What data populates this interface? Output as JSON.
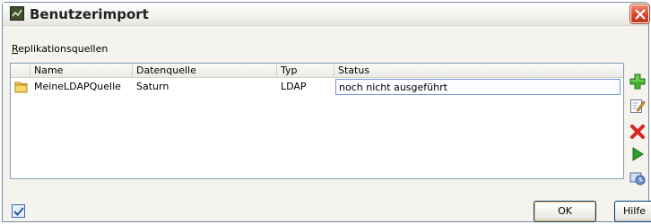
{
  "window": {
    "title": "Benutzerimport",
    "close_label": "×"
  },
  "section": {
    "label_prefix": "R",
    "label_rest": "eplikationsquellen"
  },
  "table": {
    "headers": {
      "name": "Name",
      "source": "Datenquelle",
      "type": "Typ",
      "status": "Status"
    },
    "rows": [
      {
        "name": "MeineLDAPQuelle",
        "source": "Saturn",
        "type": "LDAP",
        "status": "noch nicht ausgeführt"
      }
    ]
  },
  "toolbar": {
    "icons": [
      "add-icon",
      "edit-icon",
      "delete-icon",
      "run-icon",
      "schedule-icon"
    ]
  },
  "buttons": {
    "ok": "OK",
    "help": "Hilfe"
  },
  "colors": {
    "selection_border": "#7a96df",
    "add": "#3fa52f",
    "delete": "#d7251d",
    "run": "#2e9c2a"
  }
}
